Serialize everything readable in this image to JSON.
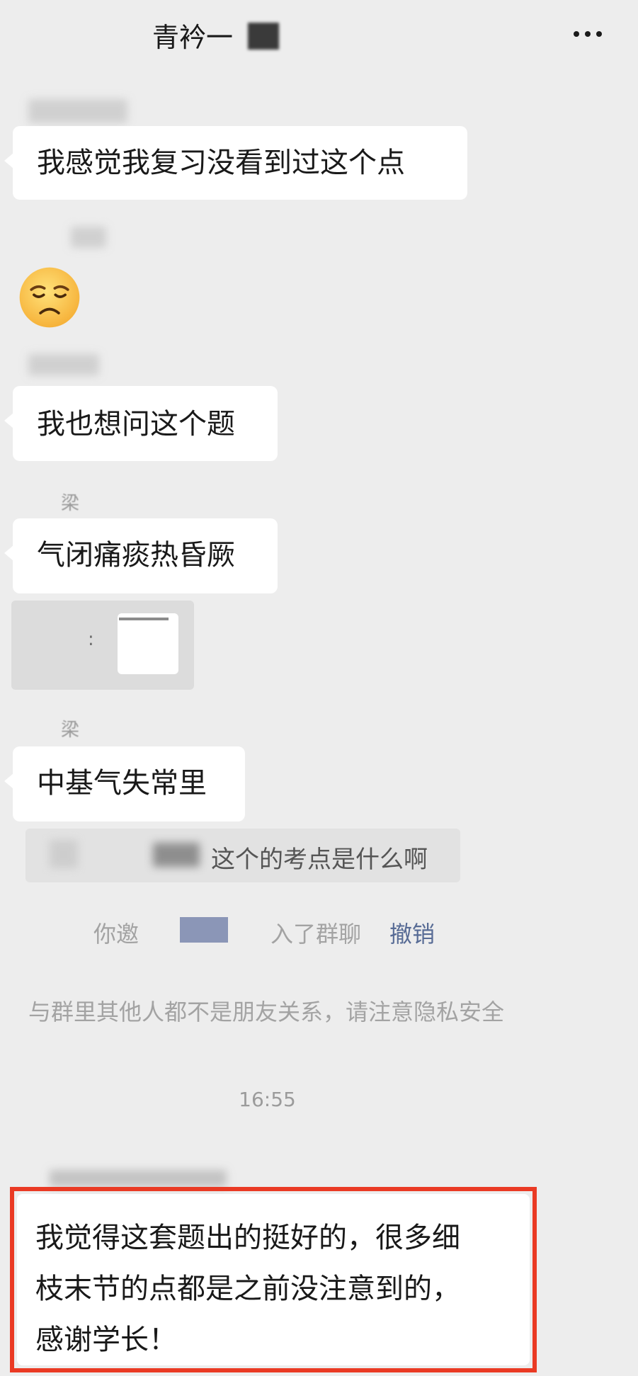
{
  "header": {
    "title": "青衿一",
    "more_icon": "more-dots-icon"
  },
  "messages": {
    "m1": "我感觉我复习没看到过这个点",
    "m3": "我也想问这个题",
    "m4_sender": "梁",
    "m4": "气闭痛痰热昏厥",
    "m5_sender": "梁",
    "m5": "中基气失常里",
    "quote": "这个的考点是什么啊",
    "final_lines": [
      "我觉得这套题出的挺好的，很多细",
      "枝末节的点都是之前没注意到的，",
      "感谢学长！"
    ]
  },
  "emoji": "worried-face-emoji",
  "system": {
    "invite_prefix": "你邀",
    "invite_suffix": "入了群聊",
    "revoke": "撤销",
    "privacy_notice": "与群里其他人都不是朋友关系，请注意隐私安全",
    "time": "16:55"
  },
  "colors": {
    "background": "#ededed",
    "bubble": "#ffffff",
    "link": "#576b95",
    "highlight_border": "#ea3a24"
  }
}
